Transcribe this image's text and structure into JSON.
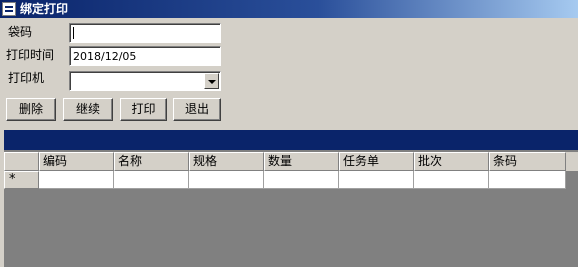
{
  "window": {
    "title": "绑定打印"
  },
  "form": {
    "bag_code_label": "袋码",
    "bag_code_value": "",
    "print_time_label": "打印时间",
    "print_time_value": "2018/12/05",
    "printer_label": "打印机",
    "printer_value": ""
  },
  "buttons": {
    "delete": "删除",
    "continue": "继续",
    "print": "打印",
    "exit": "退出"
  },
  "grid": {
    "columns": [
      "编码",
      "名称",
      "规格",
      "数量",
      "任务单",
      "批次",
      "条码"
    ],
    "new_row_marker": "*"
  },
  "colors": {
    "title_bar": "#0a246a",
    "face": "#d4d0c8",
    "grid_background": "#808080"
  }
}
